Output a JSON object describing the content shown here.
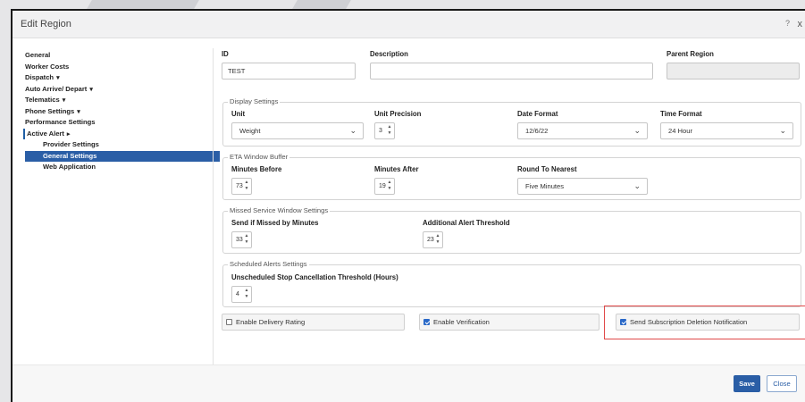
{
  "dialog": {
    "title": "Edit Region",
    "help_label": "?",
    "close_label": "x"
  },
  "nav": {
    "items": [
      {
        "label": "General",
        "arrow": ""
      },
      {
        "label": "Worker Costs",
        "arrow": ""
      },
      {
        "label": "Dispatch",
        "arrow": "▾"
      },
      {
        "label": "Auto Arrive/ Depart",
        "arrow": "▾"
      },
      {
        "label": "Telematics",
        "arrow": "▾"
      },
      {
        "label": "Phone Settings",
        "arrow": "▾"
      },
      {
        "label": "Performance Settings",
        "arrow": ""
      },
      {
        "label": "Active Alert",
        "arrow": "▸"
      },
      {
        "label": "Provider Settings",
        "arrow": ""
      },
      {
        "label": "General Settings",
        "arrow": ""
      },
      {
        "label": "Web Application",
        "arrow": ""
      }
    ]
  },
  "form": {
    "id_label": "ID",
    "id_value": "TEST",
    "description_label": "Description",
    "description_value": "",
    "parent_region_label": "Parent Region",
    "parent_region_value": ""
  },
  "display_settings": {
    "legend": "Display Settings",
    "unit_label": "Unit",
    "unit_value": "Weight",
    "unit_precision_label": "Unit Precision",
    "unit_precision_value": "3",
    "date_format_label": "Date Format",
    "date_format_value": "12/6/22",
    "time_format_label": "Time Format",
    "time_format_value": "24 Hour"
  },
  "eta_window": {
    "legend": "ETA Window Buffer",
    "minutes_before_label": "Minutes Before",
    "minutes_before_value": "73",
    "minutes_after_label": "Minutes After",
    "minutes_after_value": "19",
    "round_label": "Round To Nearest",
    "round_value": "Five Minutes"
  },
  "missed_service": {
    "legend": "Missed Service Window Settings",
    "send_label": "Send if Missed by Minutes",
    "send_value": "33",
    "threshold_label": "Additional Alert Threshold",
    "threshold_value": "23"
  },
  "scheduled_alerts": {
    "legend": "Scheduled Alerts Settings",
    "threshold_label": "Unscheduled Stop Cancellation Threshold (Hours)",
    "threshold_value": "4"
  },
  "checkboxes": {
    "delivery_rating": {
      "label": "Enable Delivery Rating",
      "checked": false
    },
    "verification": {
      "label": "Enable Verification",
      "checked": true
    },
    "subscription_deletion": {
      "label": "Send Subscription Deletion Notification",
      "checked": true
    }
  },
  "footer": {
    "save_label": "Save",
    "close_label": "Close"
  },
  "colors": {
    "accent": "#2a5ea6",
    "highlight_box": "#e04848"
  }
}
